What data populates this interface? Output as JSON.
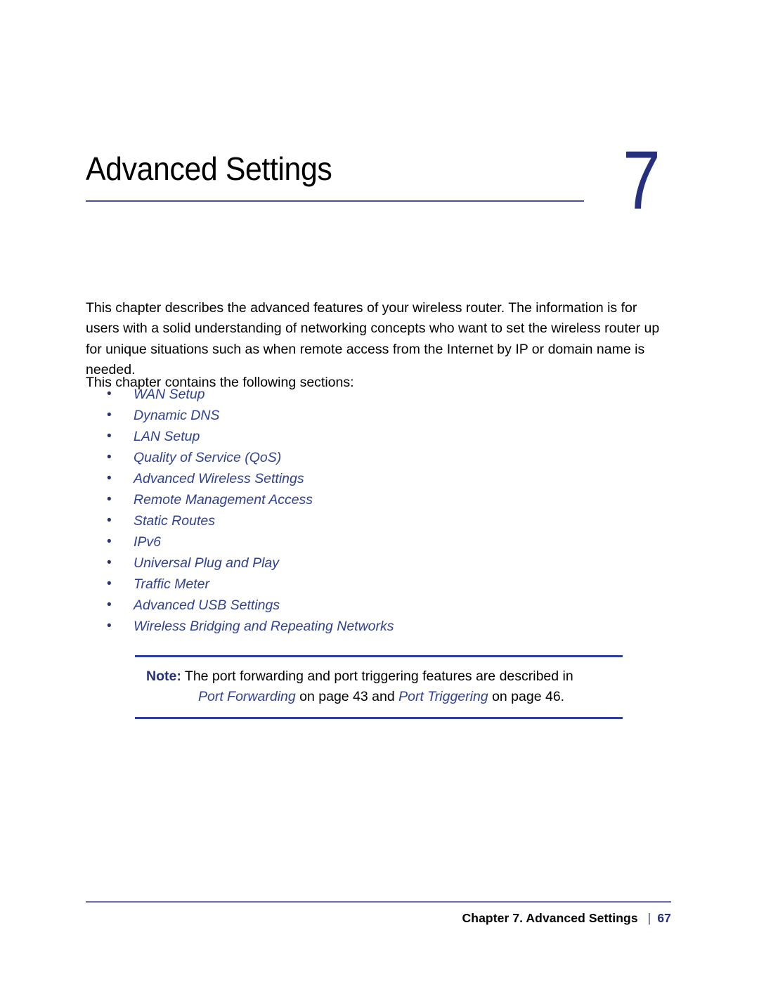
{
  "chapter": {
    "title": "Advanced Settings",
    "number": "7"
  },
  "intro_paragraph": "This chapter describes the advanced features of your wireless router. The information is for users with a solid understanding of networking concepts who want to set the wireless router up for unique situations such as when remote access from the Internet by IP or domain name is needed.",
  "contains_line": "This chapter contains the following sections:",
  "bullet_glyph": "•",
  "sections": [
    {
      "label": "WAN Setup"
    },
    {
      "label": "Dynamic DNS"
    },
    {
      "label": "LAN Setup"
    },
    {
      "label": "Quality of Service (QoS)"
    },
    {
      "label": "Advanced Wireless Settings"
    },
    {
      "label": "Remote Management Access"
    },
    {
      "label": "Static Routes"
    },
    {
      "label": "IPv6"
    },
    {
      "label": "Universal Plug and Play"
    },
    {
      "label": "Traffic Meter"
    },
    {
      "label": "Advanced USB Settings"
    },
    {
      "label": "Wireless Bridging and Repeating Networks"
    }
  ],
  "note": {
    "label": "Note:",
    "line1_text": "The port forwarding and port triggering features are described in",
    "link1": "Port Forwarding",
    "mid_text": "on page 43 and",
    "link2": "Port Triggering",
    "end_text": "on page 46."
  },
  "footer": {
    "chapter_text": "Chapter 7.  Advanced Settings",
    "separator": "|",
    "page_number": "67"
  },
  "colors": {
    "link_blue": "#2f3f92",
    "heading_navy": "#26307d",
    "rule_blue": "#4a4fa0",
    "note_rule": "#2f3f9e",
    "footer_rule": "#6a6fb5",
    "body_black": "#000000"
  }
}
